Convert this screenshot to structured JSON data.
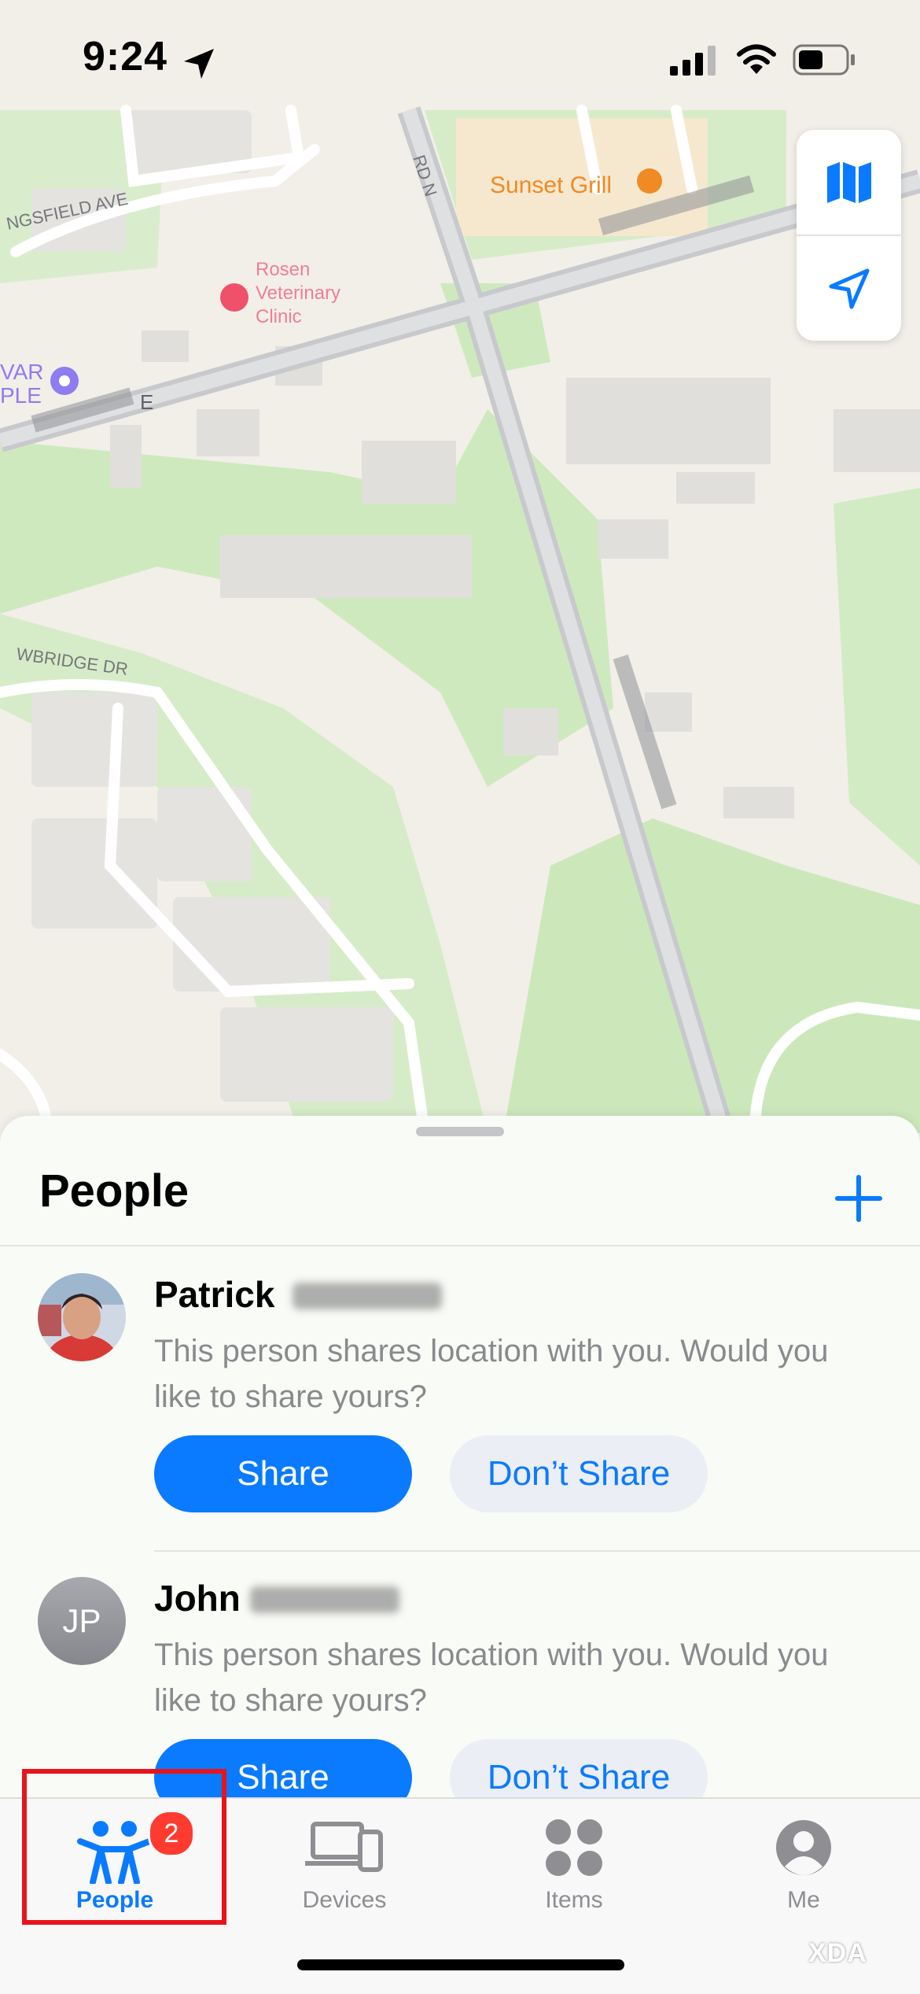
{
  "status_bar": {
    "time": "9:24"
  },
  "map": {
    "labels": {
      "restaurant": "Sunset Grill",
      "street_1": "NGSFIELD AVE",
      "street_2": "RD N",
      "street_3": "WBRIDGE DR",
      "vet_1": "Rosen",
      "vet_2": "Veterinary",
      "vet_3": "Clinic",
      "place_1": "VAR",
      "place_2": "PLE",
      "road_1": "E"
    },
    "controls": {
      "map_mode_icon": "map-icon",
      "location_icon": "location-arrow-icon"
    }
  },
  "sheet": {
    "title": "People",
    "add_icon": "plus-icon",
    "people": [
      {
        "first_name": "Patrick",
        "message": "This person shares location with you. Would you like to share yours?",
        "share_label": "Share",
        "dont_share_label": "Don’t Share"
      },
      {
        "first_name": "John",
        "initials": "JP",
        "message": "This person shares location with you. Would you like to share yours?",
        "share_label": "Share",
        "dont_share_label": "Don’t Share"
      }
    ]
  },
  "tabbar": {
    "tabs": [
      {
        "label": "People",
        "icon": "people-icon",
        "active": true,
        "badge": "2"
      },
      {
        "label": "Devices",
        "icon": "devices-icon",
        "active": false
      },
      {
        "label": "Items",
        "icon": "items-icon",
        "active": false
      },
      {
        "label": "Me",
        "icon": "person-circle-icon",
        "active": false
      }
    ]
  },
  "watermark": "XDA",
  "colors": {
    "accent": "#0a7aff",
    "badge": "#ff3b30",
    "highlight": "#e8141c",
    "restaurant": "#f08a24"
  }
}
